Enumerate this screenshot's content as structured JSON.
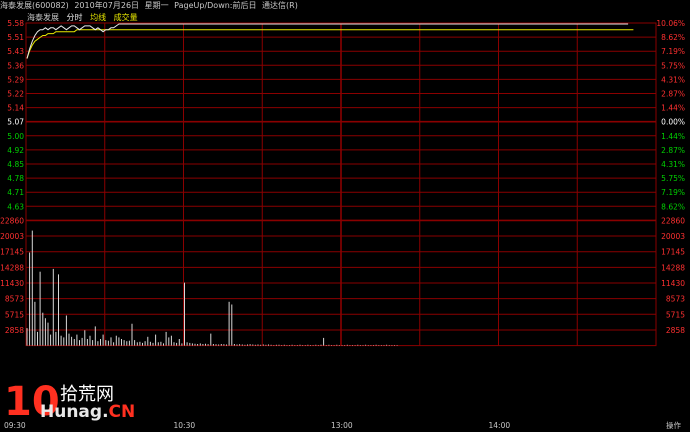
{
  "header": {
    "stock": "海泰发展(600082)",
    "date": "2010年07月26日",
    "weekday": "星期一",
    "hint": "PageUp/Down:前后日",
    "extra": "通达信(R)"
  },
  "legend": {
    "name": "海泰发展",
    "minute": "分时",
    "avg": "均线",
    "volume": "成交量"
  },
  "colors": {
    "background": "#000000",
    "grid": "#8a0000",
    "price_line": "#e8e8e8",
    "avg_line": "#e8e800",
    "up_text": "#ff3030",
    "flat_text": "#ffffff",
    "down_text": "#00d000",
    "axis_text": "#c8c8c8"
  },
  "chart_data": [
    {
      "type": "line",
      "prev_close": 5.07,
      "ylim": [
        4.56,
        5.58
      ],
      "price_ticks": [
        "5.58",
        "5.51",
        "5.43",
        "5.36",
        "5.29",
        "5.22",
        "5.14",
        "5.07",
        "5.00",
        "4.92",
        "4.85",
        "4.78",
        "4.71",
        "4.63"
      ],
      "percent_ticks": [
        "10.06%",
        "8.62%",
        "7.19%",
        "5.75%",
        "4.31%",
        "2.87%",
        "1.44%",
        "0.00%",
        "1.44%",
        "2.87%",
        "4.31%",
        "5.75%",
        "7.19%",
        "8.62%"
      ],
      "series": [
        {
          "values": [
            5.4,
            5.45,
            5.49,
            5.52,
            5.54,
            5.55,
            5.55,
            5.56,
            5.55,
            5.56,
            5.56,
            5.55,
            5.56,
            5.57,
            5.56,
            5.55,
            5.56,
            5.57,
            5.57,
            5.56,
            5.55,
            5.56,
            5.57,
            5.57,
            5.57,
            5.56,
            5.55,
            5.56,
            5.55,
            5.54,
            5.55,
            5.55,
            5.56,
            5.56,
            5.57,
            5.58,
            5.58,
            5.58,
            5.58,
            5.58,
            5.58,
            5.58,
            5.58,
            5.58,
            5.58,
            5.58,
            5.58,
            5.58,
            5.58,
            5.58,
            5.58,
            5.58,
            5.58,
            5.58,
            5.58,
            5.58,
            5.58,
            5.58,
            5.58,
            5.58,
            5.58,
            5.58,
            5.58,
            5.58,
            5.58,
            5.58,
            5.58,
            5.58,
            5.58,
            5.58,
            5.58,
            5.58,
            5.58,
            5.58,
            5.58,
            5.58,
            5.58,
            5.58,
            5.58,
            5.58,
            5.58,
            5.58,
            5.58,
            5.58,
            5.58,
            5.58,
            5.58,
            5.58,
            5.58,
            5.58,
            5.58,
            5.58,
            5.58,
            5.58,
            5.58,
            5.58,
            5.58,
            5.58,
            5.58,
            5.58,
            5.58,
            5.58,
            5.58,
            5.58,
            5.58,
            5.58,
            5.58,
            5.58,
            5.58,
            5.58,
            5.58,
            5.58,
            5.58,
            5.58,
            5.58,
            5.58,
            5.58,
            5.58,
            5.58,
            5.58,
            5.58,
            5.58,
            5.58,
            5.58,
            5.58,
            5.58,
            5.58,
            5.58,
            5.58,
            5.58,
            5.58,
            5.58,
            5.58,
            5.58,
            5.58,
            5.58,
            5.58,
            5.58,
            5.58,
            5.58,
            5.58,
            5.58,
            5.58,
            5.58,
            5.58,
            5.58,
            5.58,
            5.58,
            5.58,
            5.58,
            5.58,
            5.58,
            5.58,
            5.58,
            5.58,
            5.58,
            5.58,
            5.58,
            5.58,
            5.58,
            5.58,
            5.58,
            5.58,
            5.58,
            5.58,
            5.58,
            5.58,
            5.58,
            5.58,
            5.58,
            5.58,
            5.58,
            5.58,
            5.58,
            5.58,
            5.58,
            5.58,
            5.58,
            5.58,
            5.58,
            5.58,
            5.58,
            5.58,
            5.58,
            5.58,
            5.58,
            5.58,
            5.58,
            5.58,
            5.58,
            5.58,
            5.58,
            5.58,
            5.58,
            5.58,
            5.58,
            5.58,
            5.58,
            5.58,
            5.58,
            5.58,
            5.58,
            5.58,
            5.58,
            5.58,
            5.58,
            5.58,
            5.58,
            5.58,
            5.58,
            5.58,
            5.58,
            5.58,
            5.58,
            5.58,
            5.58,
            5.58,
            5.58,
            5.58,
            5.58,
            5.58,
            5.58,
            5.58,
            5.58,
            5.58,
            5.58,
            5.58,
            5.58,
            5.58,
            5.58
          ]
        },
        {
          "values": [
            5.4,
            5.44,
            5.47,
            5.49,
            5.5,
            5.51,
            5.52,
            5.52,
            5.53,
            5.53,
            5.53,
            5.54,
            5.54,
            5.54,
            5.54,
            5.54,
            5.54,
            5.54,
            5.54,
            5.55,
            5.55,
            5.55,
            5.55,
            5.55,
            5.55,
            5.55,
            5.55,
            5.55,
            5.55,
            5.55,
            5.55,
            5.55,
            5.55,
            5.55,
            5.55,
            5.55,
            5.55,
            5.55,
            5.55,
            5.55,
            5.55,
            5.55,
            5.55,
            5.55,
            5.55,
            5.55,
            5.55,
            5.55,
            5.55,
            5.55,
            5.55,
            5.55,
            5.55,
            5.55,
            5.55,
            5.55,
            5.55,
            5.55,
            5.55,
            5.55,
            5.55,
            5.55,
            5.55,
            5.55,
            5.55,
            5.55,
            5.55,
            5.55,
            5.55,
            5.55,
            5.55,
            5.55,
            5.55,
            5.55,
            5.55,
            5.55,
            5.55,
            5.55,
            5.55,
            5.55,
            5.55,
            5.55,
            5.55,
            5.55,
            5.55,
            5.55,
            5.55,
            5.55,
            5.55,
            5.55,
            5.55,
            5.55,
            5.55,
            5.55,
            5.55,
            5.55,
            5.55,
            5.55,
            5.55,
            5.55,
            5.55,
            5.55,
            5.55,
            5.55,
            5.55,
            5.55,
            5.55,
            5.55,
            5.55,
            5.55,
            5.55,
            5.55,
            5.55,
            5.55,
            5.55,
            5.55,
            5.55,
            5.55,
            5.55,
            5.55,
            5.55,
            5.55,
            5.55,
            5.55,
            5.55,
            5.55,
            5.55,
            5.55,
            5.55,
            5.55,
            5.55,
            5.55,
            5.55,
            5.55,
            5.55,
            5.55,
            5.55,
            5.55,
            5.55,
            5.55,
            5.55,
            5.55,
            5.55,
            5.55,
            5.55,
            5.55,
            5.55,
            5.55,
            5.55,
            5.55,
            5.55,
            5.55,
            5.55,
            5.55,
            5.55,
            5.55,
            5.55,
            5.55,
            5.55,
            5.55,
            5.55,
            5.55,
            5.55,
            5.55,
            5.55,
            5.55,
            5.55,
            5.55,
            5.55,
            5.55,
            5.55,
            5.55,
            5.55,
            5.55,
            5.55,
            5.55,
            5.55,
            5.55,
            5.55,
            5.55,
            5.55,
            5.55,
            5.55,
            5.55,
            5.55,
            5.55,
            5.55,
            5.55,
            5.55,
            5.55,
            5.55,
            5.55,
            5.55,
            5.55,
            5.55,
            5.55,
            5.55,
            5.55,
            5.55,
            5.55,
            5.55,
            5.55,
            5.55,
            5.55,
            5.55,
            5.55,
            5.55,
            5.55,
            5.55,
            5.55,
            5.55,
            5.55,
            5.55,
            5.55,
            5.55,
            5.55,
            5.55,
            5.55,
            5.55,
            5.55,
            5.55,
            5.55,
            5.55,
            5.55,
            5.55,
            5.55,
            5.55,
            5.55,
            5.55,
            5.55,
            5.55,
            5.55
          ]
        }
      ]
    },
    {
      "type": "bar",
      "ylim": [
        0,
        22860
      ],
      "vol_ticks": [
        "22860",
        "20003",
        "17145",
        "14288",
        "11430",
        "8573",
        "5715",
        "2858"
      ],
      "values": [
        3200,
        17000,
        21000,
        8000,
        2500,
        13500,
        6000,
        5000,
        4200,
        2000,
        14000,
        2500,
        13000,
        1800,
        1500,
        5500,
        2200,
        1600,
        1200,
        2000,
        1000,
        1400,
        2800,
        1200,
        1800,
        1000,
        3500,
        800,
        1200,
        2000,
        1000,
        900,
        1500,
        600,
        1800,
        1500,
        1200,
        1000,
        800,
        900,
        4000,
        1000,
        600,
        700,
        500,
        800,
        1600,
        700,
        500,
        2000,
        600,
        700,
        400,
        2500,
        1500,
        1800,
        600,
        500,
        1200,
        400,
        11500,
        600,
        500,
        400,
        350,
        300,
        400,
        300,
        350,
        250,
        2200,
        300,
        250,
        200,
        300,
        250,
        200,
        8000,
        7500,
        300,
        200,
        250,
        200,
        150,
        200,
        250,
        200,
        150,
        200,
        150,
        200,
        150,
        200,
        150,
        100,
        150,
        150,
        100,
        150,
        100,
        100,
        150,
        100,
        100,
        150,
        100,
        100,
        150,
        100,
        100,
        150,
        100,
        150,
        1400,
        100,
        150,
        100,
        100,
        150,
        100,
        100,
        100,
        150,
        100,
        100,
        100,
        150,
        100,
        100,
        150,
        100,
        100,
        100,
        150,
        100,
        100,
        100,
        150,
        100,
        100,
        100,
        100
      ]
    }
  ],
  "time_axis": {
    "labels": [
      "09:30",
      "10:30",
      "13:00",
      "14:00"
    ],
    "corner": "操作"
  },
  "watermark": {
    "number": "10",
    "cn": "拾荒网",
    "site_a": "Hunag.",
    "site_b": "CN"
  }
}
